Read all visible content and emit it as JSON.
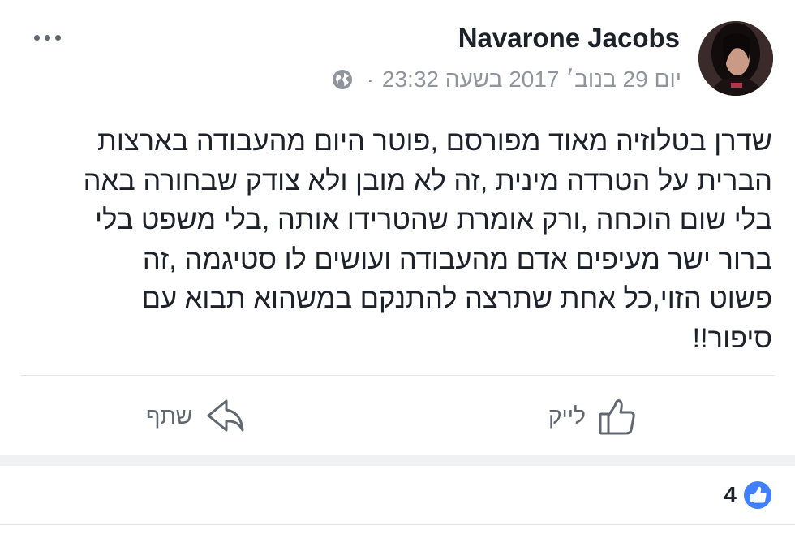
{
  "post": {
    "author_name": "Navarone Jacobs",
    "timestamp": "יום 29 בנוב׳ 2017 בשעה 23:32",
    "meta_separator": "·",
    "privacy_icon": "globe-icon",
    "more_icon": "more-options-icon",
    "text_lines": [
      "שדרן בטלוזיה מאוד מפורסם ,פוטר היום מהעבודה בארצות",
      "הברית על הטרדה מינית ,זה לא מובן ולא צודק שבחורה באה",
      "בלי שום הוכחה ,ורק אומרת שהטרידו אותה ,בלי משפט בלי",
      "ברור ישר מעיפים אדם מהעבודה ועושים לו סטיגמה ,זה",
      "פשוט הזוי,כל אחת שתרצה להתנקם במשהוא תבוא עם",
      "סיפור!!"
    ]
  },
  "actions": {
    "like_label": "לייק",
    "like_icon": "thumbs-up-icon",
    "share_label": "שתף",
    "share_icon": "share-arrow-icon"
  },
  "reactions": {
    "count": "4",
    "icon": "like-reaction-icon"
  },
  "colors": {
    "text": "#1d2129",
    "secondary": "#90949c",
    "action": "#606770",
    "like_blue": "#4080ff",
    "divider": "#e5e6e9"
  }
}
